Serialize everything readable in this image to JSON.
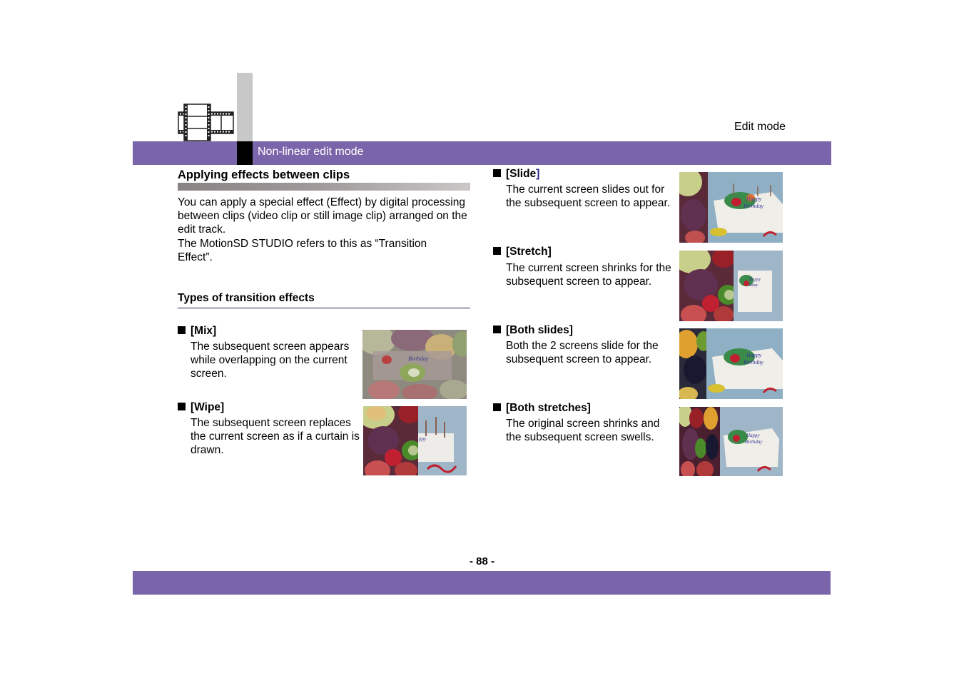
{
  "header": {
    "section_label": "Edit mode",
    "bar_title": "Non-linear edit mode",
    "icon": "film-strip-icon",
    "colors": {
      "bar": "#7b65aa",
      "tab_gray": "#c8c8c8",
      "tab_black": "#000000"
    }
  },
  "main": {
    "title": "Applying effects between clips",
    "intro": [
      "You can apply a special effect (Effect) by digital processing between clips (video clip or still image clip) arranged on the edit track.",
      "The MotionSD STUDIO refers to this as “Transition Effect”."
    ],
    "subtitle": "Types of transition effects",
    "effects": [
      {
        "name": "[Mix]",
        "description": "The subsequent screen appears while overlapping on the current screen.",
        "image": "mix-transition-preview"
      },
      {
        "name": "[Wipe]",
        "description": "The subsequent screen replaces the current screen as if a curtain is drawn.",
        "image": "wipe-transition-preview"
      },
      {
        "name_open": "[Slide",
        "name_close": "]",
        "name": "[Slide]",
        "description": "The current screen slides out for the subsequent screen to appear.",
        "image": "slide-transition-preview"
      },
      {
        "name": "[Stretch]",
        "description": "The current screen shrinks for the subsequent screen to appear.",
        "image": "stretch-transition-preview"
      },
      {
        "name": "[Both slides]",
        "description": "Both the 2 screens slide for the subsequent screen to appear.",
        "image": "both-slides-transition-preview"
      },
      {
        "name": "[Both stretches]",
        "description": "The original screen shrinks and the subsequent screen swells.",
        "image": "both-stretches-transition-preview"
      }
    ]
  },
  "footer": {
    "page_number": "- 88 -"
  }
}
